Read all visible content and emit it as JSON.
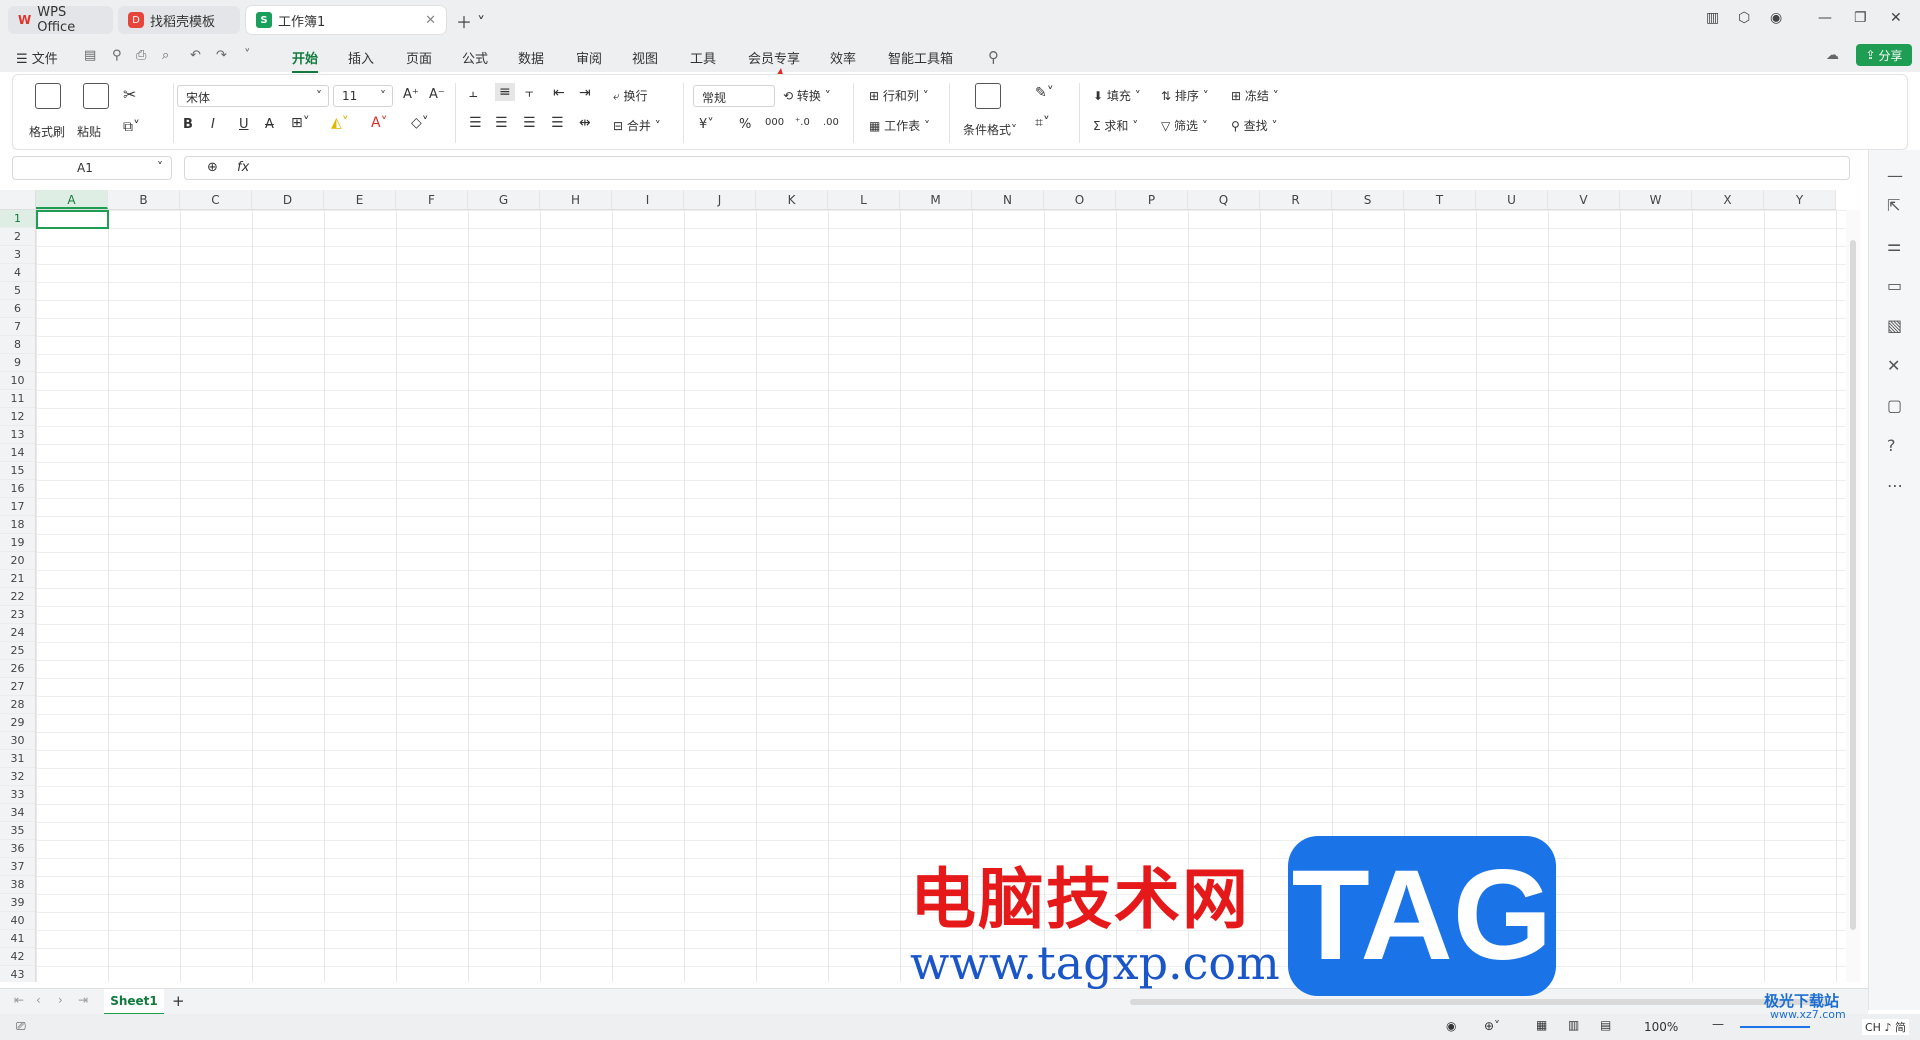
{
  "tabs": [
    {
      "label": "WPS Office"
    },
    {
      "label": "找稻壳模板"
    },
    {
      "label": "工作簿1"
    }
  ],
  "menu": {
    "file": "文件",
    "items": [
      "开始",
      "插入",
      "页面",
      "公式",
      "数据",
      "审阅",
      "视图",
      "工具",
      "会员专享",
      "效率",
      "智能工具箱"
    ],
    "active": "开始",
    "share": "分享"
  },
  "ribbon": {
    "format_painter": "格式刷",
    "paste": "粘贴",
    "font_name": "宋体",
    "font_size": "11",
    "wrap": "换行",
    "merge": "合并",
    "number_format": "常规",
    "convert": "转换",
    "row_col": "行和列",
    "worksheet": "工作表",
    "cond_format": "条件格式",
    "fill": "填充",
    "sort": "排序",
    "freeze": "冻结",
    "sum": "求和",
    "filter": "筛选",
    "find": "查找"
  },
  "formula": {
    "cell_ref": "A1",
    "fx": "fx"
  },
  "columns": [
    "A",
    "B",
    "C",
    "D",
    "E",
    "F",
    "G",
    "H",
    "I",
    "J",
    "K",
    "L",
    "M",
    "N",
    "O",
    "P",
    "Q",
    "R",
    "S",
    "T",
    "U",
    "V",
    "W",
    "X",
    "Y"
  ],
  "rows": [
    "1",
    "2",
    "3",
    "4",
    "5",
    "6",
    "7",
    "8",
    "9",
    "10",
    "11",
    "12",
    "13",
    "14",
    "15",
    "16",
    "17",
    "18",
    "19",
    "20",
    "21",
    "22",
    "23",
    "24",
    "25",
    "26",
    "27",
    "28",
    "29",
    "30",
    "31",
    "32",
    "33",
    "34",
    "35",
    "36",
    "37",
    "38",
    "39",
    "40",
    "41",
    "42",
    "43"
  ],
  "sheet": {
    "name": "Sheet1",
    "add": "+"
  },
  "status": {
    "zoom": "100%",
    "ime": "CH ♪ 简"
  },
  "watermark": {
    "cn": "电脑技术网",
    "url": "www.tagxp.com",
    "tag": "TAG",
    "site": "极光下载站",
    "site2": "www.xz7.com"
  }
}
